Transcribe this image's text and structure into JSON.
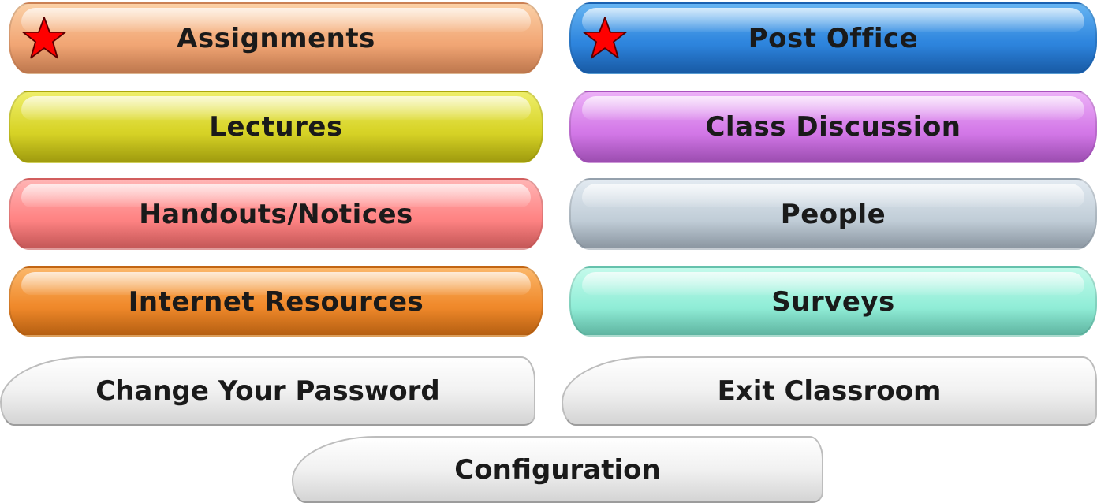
{
  "menu": {
    "assignments": {
      "label": "Assignments",
      "color": "#f2a877",
      "icon": "star-icon",
      "icon_color": "#ff0000"
    },
    "post_office": {
      "label": "Post Office",
      "color": "#2f86de",
      "icon": "star-icon",
      "icon_color": "#ff0000"
    },
    "lectures": {
      "label": "Lectures",
      "color": "#d8d428"
    },
    "class_discussion": {
      "label": "Class Discussion",
      "color": "#d47ae8"
    },
    "handouts": {
      "label": "Handouts/Notices",
      "color": "#ff8585"
    },
    "people": {
      "label": "People",
      "color": "#c3cfd9"
    },
    "internet_resources": {
      "label": "Internet Resources",
      "color": "#f08a2c"
    },
    "surveys": {
      "label": "Surveys",
      "color": "#93eed8"
    }
  },
  "tabs": {
    "change_password": {
      "label": "Change Your Password"
    },
    "exit_classroom": {
      "label": "Exit Classroom"
    },
    "configuration": {
      "label": "Configuration"
    }
  }
}
